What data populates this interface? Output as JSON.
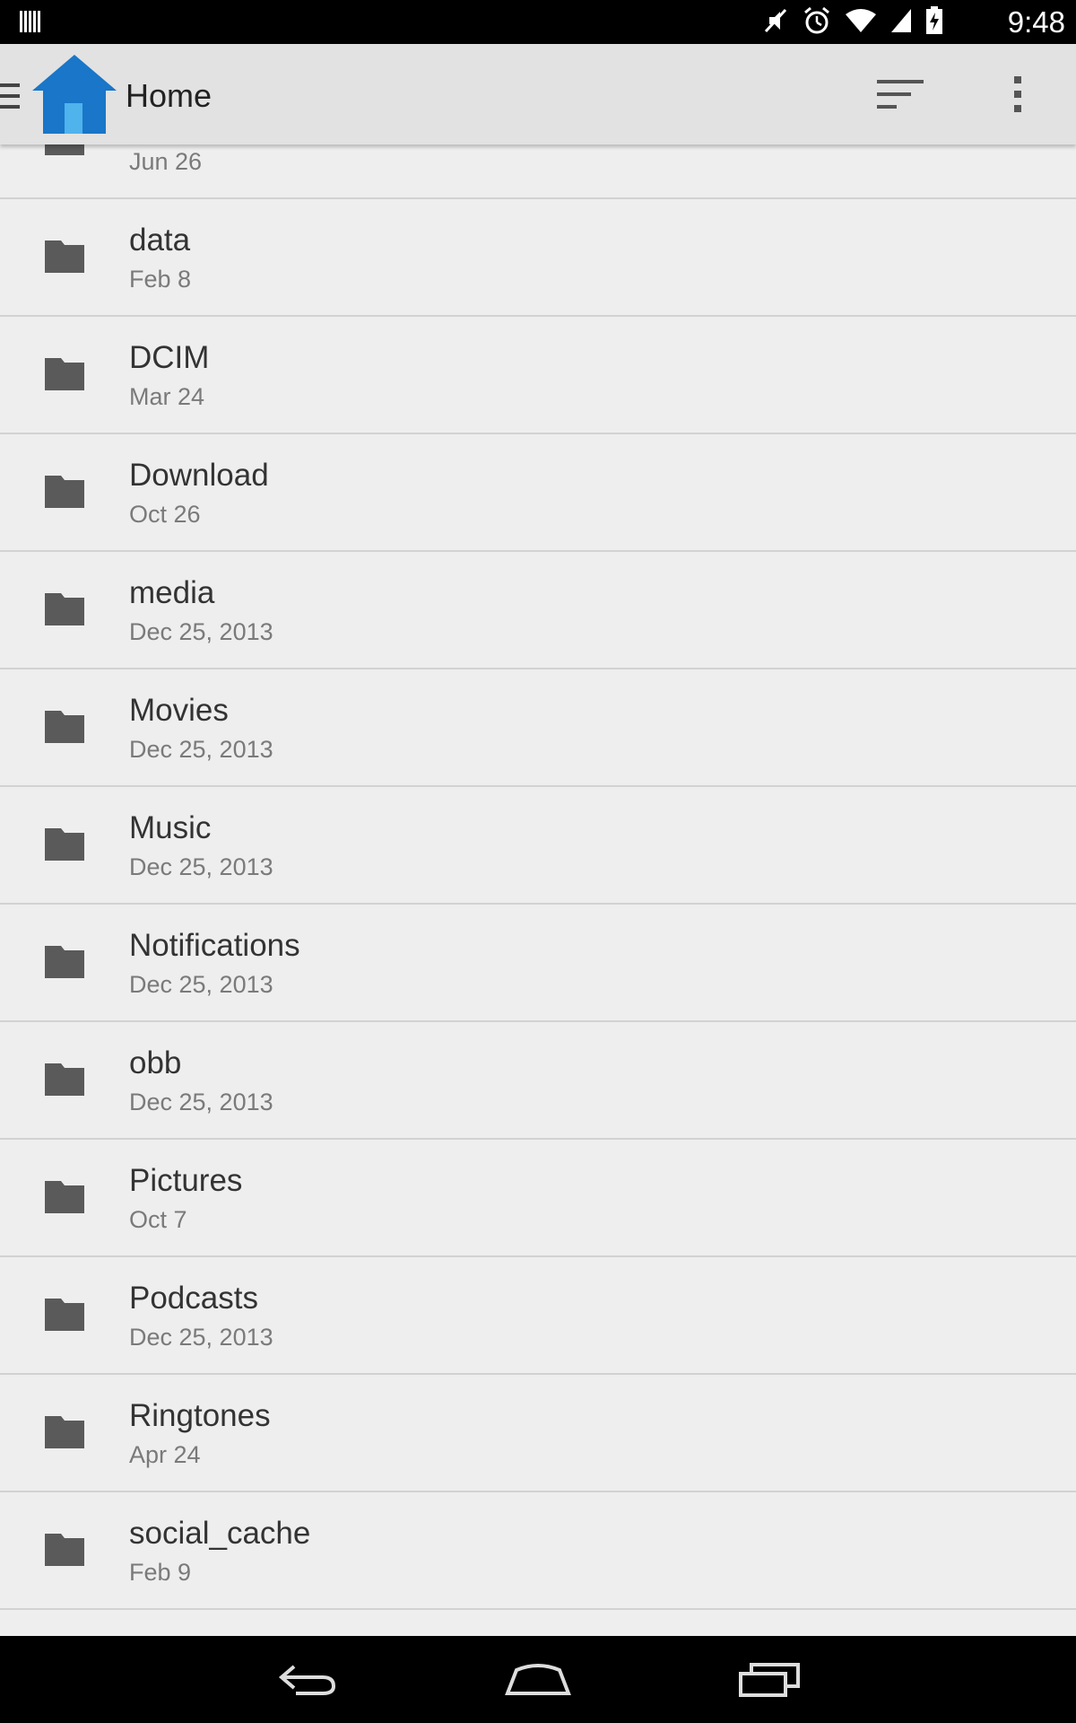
{
  "status_bar": {
    "time": "9:48",
    "icons": [
      "barcode-icon",
      "mute-icon",
      "alarm-icon",
      "wifi-icon",
      "signal-icon",
      "battery-charging-icon"
    ]
  },
  "action_bar": {
    "title": "Home",
    "icons": [
      "drawer-icon",
      "home-folder-icon",
      "sort-icon",
      "overflow-menu-icon"
    ]
  },
  "files": [
    {
      "name": "",
      "date": "Jun 26"
    },
    {
      "name": "data",
      "date": "Feb 8"
    },
    {
      "name": "DCIM",
      "date": "Mar 24"
    },
    {
      "name": "Download",
      "date": "Oct 26"
    },
    {
      "name": "media",
      "date": "Dec 25, 2013"
    },
    {
      "name": "Movies",
      "date": "Dec 25, 2013"
    },
    {
      "name": "Music",
      "date": "Dec 25, 2013"
    },
    {
      "name": "Notifications",
      "date": "Dec 25, 2013"
    },
    {
      "name": "obb",
      "date": "Dec 25, 2013"
    },
    {
      "name": "Pictures",
      "date": "Oct 7"
    },
    {
      "name": "Podcasts",
      "date": "Dec 25, 2013"
    },
    {
      "name": "Ringtones",
      "date": "Apr 24"
    },
    {
      "name": "social_cache",
      "date": "Feb 9"
    },
    {
      "name": "",
      "date": ""
    }
  ],
  "nav_bar": {
    "icons": [
      "back-icon",
      "home-icon",
      "recent-apps-icon"
    ]
  },
  "colors": {
    "app_icon_blue": "#1976c8",
    "folder_icon": "#5a5a5a",
    "background": "#eeeeee",
    "action_bar": "#e2e2e2"
  }
}
